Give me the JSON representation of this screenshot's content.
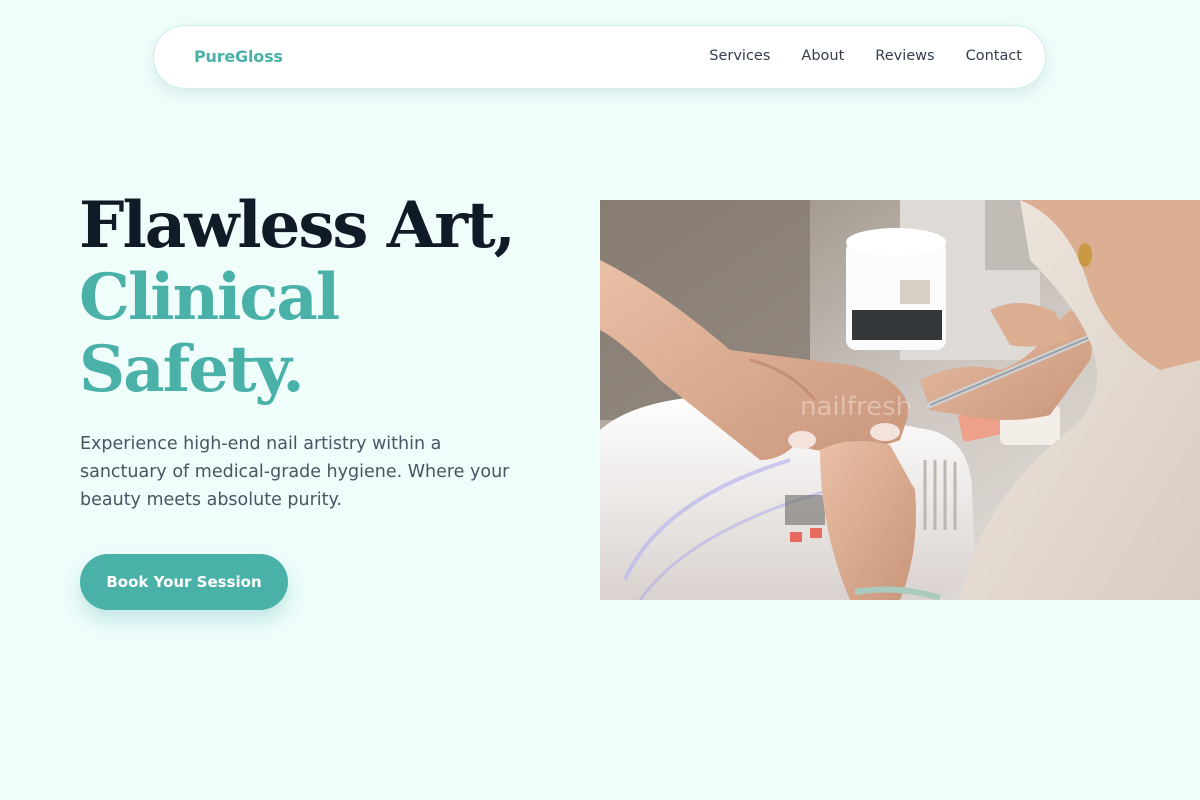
{
  "nav": {
    "brand": "PureGloss",
    "links": [
      {
        "label": "Services"
      },
      {
        "label": "About"
      },
      {
        "label": "Reviews"
      },
      {
        "label": "Contact"
      }
    ]
  },
  "hero": {
    "headline_line1": "Flawless Art,",
    "headline_line2": "Clinical",
    "headline_line3": "Safety.",
    "description": "Experience high-end nail artistry within a sanctuary of medical-grade hygiene. Where your beauty meets absolute purity.",
    "cta_label": "Book Your Session",
    "photo_alt": "Manicurist shaping a client's nails over a UV lamp"
  },
  "colors": {
    "accent": "#4ab1a8",
    "background": "#effdfb",
    "heading_dark": "#111b27",
    "body_text": "#4a5563"
  }
}
